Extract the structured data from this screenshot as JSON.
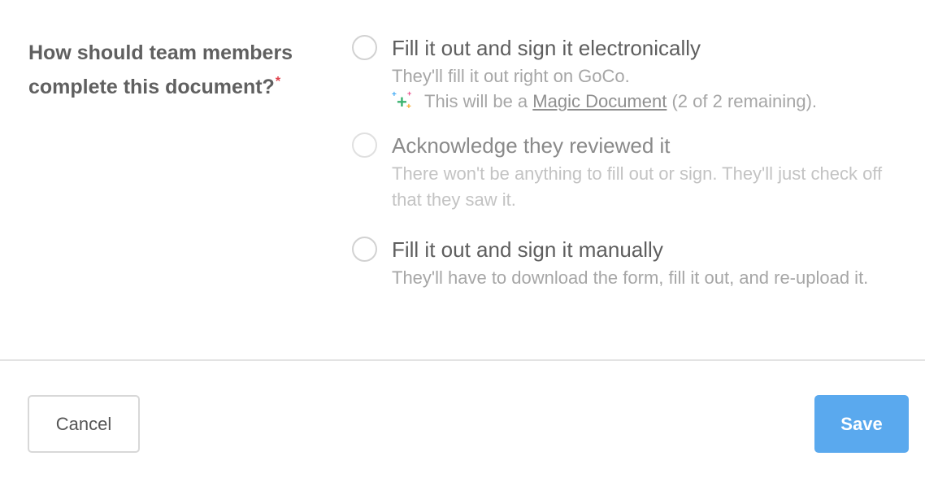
{
  "question": {
    "text": "How should team members complete this document?",
    "required_mark": "*"
  },
  "options": [
    {
      "label": "Fill it out and sign it electronically",
      "description": "They'll fill it out right on GoCo.",
      "magic": {
        "prefix": "This will be a",
        "link_text": "Magic Document",
        "suffix": "(2 of 2 remaining)."
      }
    },
    {
      "label": "Acknowledge they reviewed it",
      "description": "There won't be anything to fill out or sign. They'll just check off that they saw it."
    },
    {
      "label": "Fill it out and sign it manually",
      "description": "They'll have to download the form, fill it out, and re-upload it."
    }
  ],
  "footer": {
    "cancel_label": "Cancel",
    "save_label": "Save"
  },
  "colors": {
    "save_button": "#5aa9ee",
    "required_asterisk": "#e0424c",
    "sparkle_green": "#3cb371",
    "sparkle_blue": "#3fa9f5",
    "sparkle_pink": "#e94b8a",
    "sparkle_orange": "#f5a623"
  },
  "icons": {
    "magic": "sparkle-plus-icon"
  }
}
